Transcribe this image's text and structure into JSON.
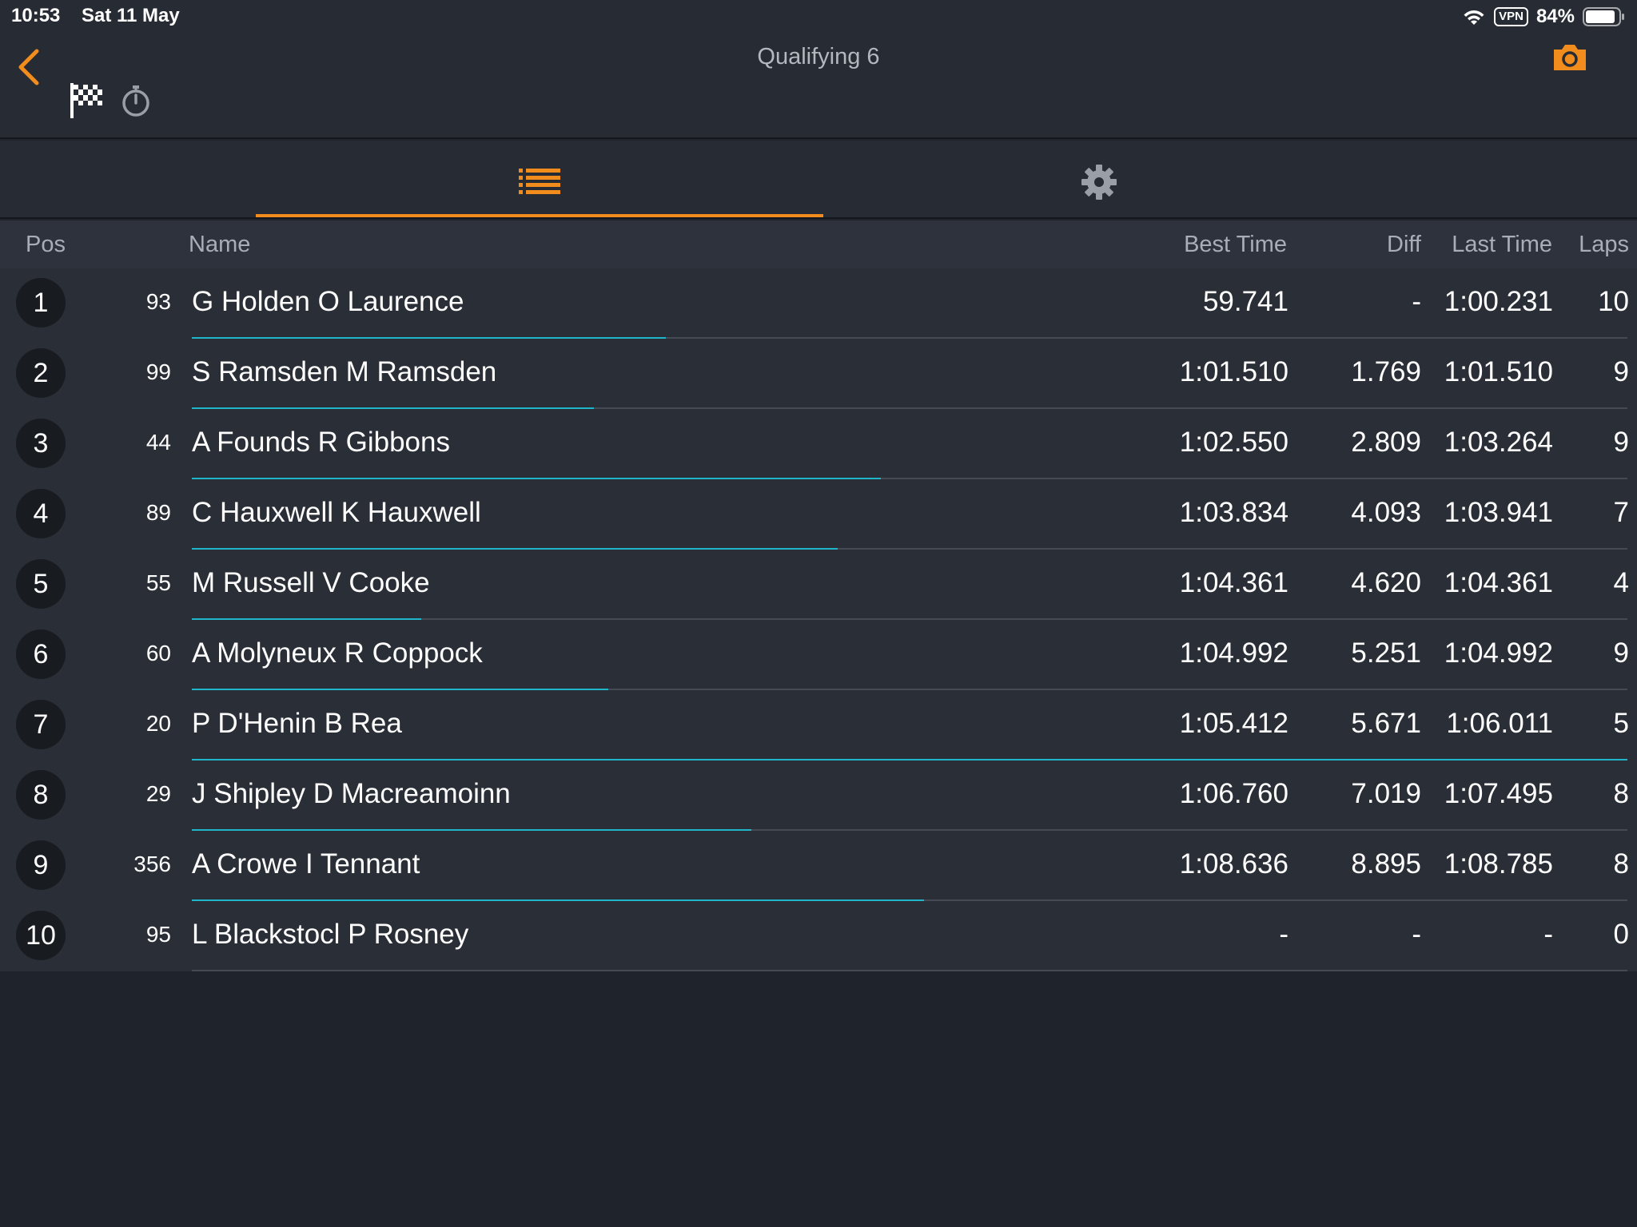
{
  "status_bar": {
    "time": "10:53",
    "date": "Sat 11 May",
    "vpn": "VPN",
    "battery": "84%"
  },
  "header": {
    "title": "Qualifying 6",
    "icons": [
      "back-icon",
      "checkered-flag-icon",
      "stopwatch-icon",
      "camera-icon"
    ]
  },
  "tabs": [
    {
      "icon": "list-icon",
      "selected": true
    },
    {
      "icon": "gear-icon",
      "selected": false
    }
  ],
  "colors": {
    "accent": "#f28c1c",
    "progress": "#1fb6c9",
    "background": "#1f232b",
    "row": "#2a2e37"
  },
  "table": {
    "columns": {
      "pos": "Pos",
      "name": "Name",
      "best_time": "Best Time",
      "diff": "Diff",
      "last_time": "Last Time",
      "laps": "Laps"
    },
    "rows": [
      {
        "pos": "1",
        "number": "93",
        "name": "G Holden O Laurence",
        "best_time": "59.741",
        "diff": "-",
        "last_time": "1:00.231",
        "laps": "10",
        "progress": 0.33
      },
      {
        "pos": "2",
        "number": "99",
        "name": "S Ramsden M Ramsden",
        "best_time": "1:01.510",
        "diff": "1.769",
        "last_time": "1:01.510",
        "laps": "9",
        "progress": 0.28
      },
      {
        "pos": "3",
        "number": "44",
        "name": "A Founds R Gibbons",
        "best_time": "1:02.550",
        "diff": "2.809",
        "last_time": "1:03.264",
        "laps": "9",
        "progress": 0.48
      },
      {
        "pos": "4",
        "number": "89",
        "name": "C Hauxwell K Hauxwell",
        "best_time": "1:03.834",
        "diff": "4.093",
        "last_time": "1:03.941",
        "laps": "7",
        "progress": 0.45
      },
      {
        "pos": "5",
        "number": "55",
        "name": "M Russell V Cooke",
        "best_time": "1:04.361",
        "diff": "4.620",
        "last_time": "1:04.361",
        "laps": "4",
        "progress": 0.16
      },
      {
        "pos": "6",
        "number": "60",
        "name": "A Molyneux R Coppock",
        "best_time": "1:04.992",
        "diff": "5.251",
        "last_time": "1:04.992",
        "laps": "9",
        "progress": 0.29
      },
      {
        "pos": "7",
        "number": "20",
        "name": "P D'Henin B Rea",
        "best_time": "1:05.412",
        "diff": "5.671",
        "last_time": "1:06.011",
        "laps": "5",
        "progress": 1.0
      },
      {
        "pos": "8",
        "number": "29",
        "name": "J Shipley D Macreamoinn",
        "best_time": "1:06.760",
        "diff": "7.019",
        "last_time": "1:07.495",
        "laps": "8",
        "progress": 0.39
      },
      {
        "pos": "9",
        "number": "356",
        "name": "A Crowe I Tennant",
        "best_time": "1:08.636",
        "diff": "8.895",
        "last_time": "1:08.785",
        "laps": "8",
        "progress": 0.51
      },
      {
        "pos": "10",
        "number": "95",
        "name": "L Blackstocl P Rosney",
        "best_time": "-",
        "diff": "-",
        "last_time": "-",
        "laps": "0",
        "progress": 0
      }
    ]
  }
}
